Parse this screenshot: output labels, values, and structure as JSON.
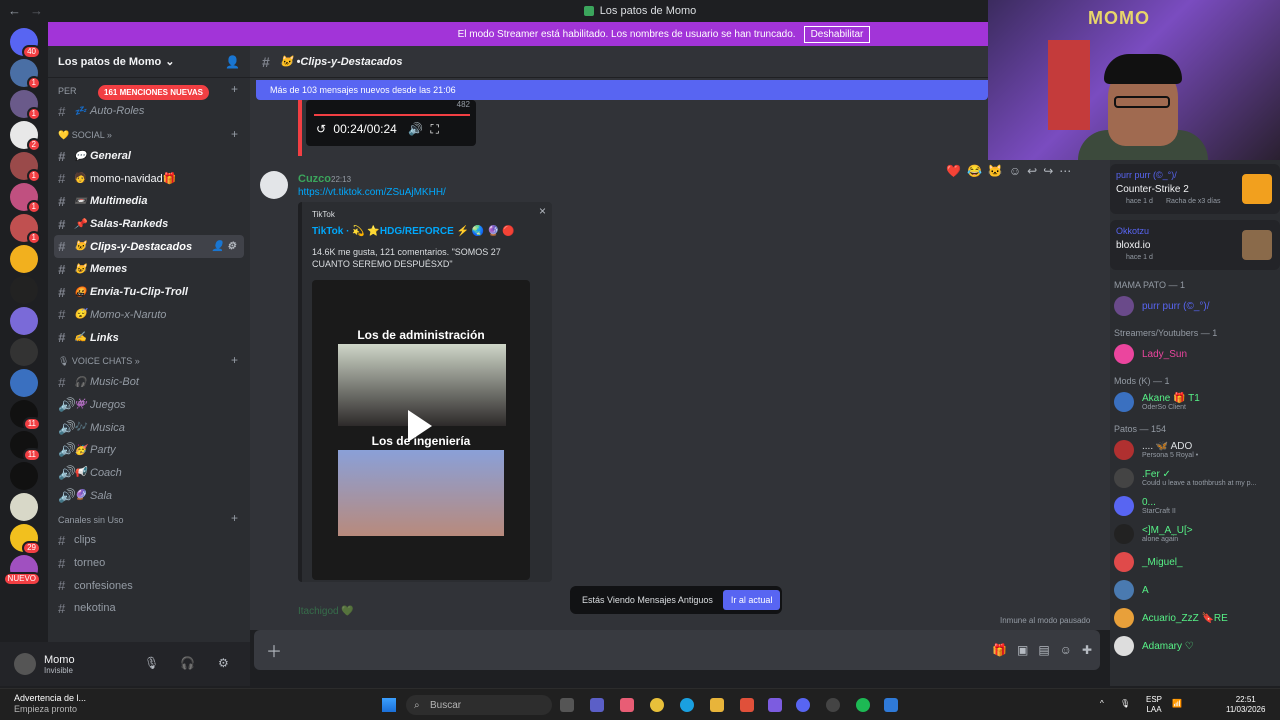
{
  "window": {
    "title": "Los patos de Momo"
  },
  "streamer_banner": {
    "text": "El modo Streamer está habilitado. Los nombres de usuario se han truncado.",
    "button": "Deshabilitar"
  },
  "guilds": [
    {
      "badge": "40"
    },
    {
      "badge": "1"
    },
    {
      "badge": "1"
    },
    {
      "badge": "2"
    },
    {
      "badge": "1"
    },
    {
      "badge": "1"
    },
    {
      "badge": "1"
    },
    {
      "badge": ""
    },
    {
      "badge": ""
    },
    {
      "badge": ""
    },
    {
      "badge": ""
    },
    {
      "badge": ""
    },
    {
      "badge": "11"
    },
    {
      "badge": "11"
    },
    {
      "badge": ""
    },
    {
      "badge": ""
    },
    {
      "badge": "29"
    },
    {
      "badge": "NUEVO"
    }
  ],
  "server": {
    "name": "Los patos de Momo",
    "mentions": "161 MENCIONES NUEVAS"
  },
  "channels": [
    {
      "type": "cat",
      "label": "PER"
    },
    {
      "type": "ch",
      "emoji": "💤",
      "label": "Auto-Roles",
      "style": "ital"
    },
    {
      "type": "cat",
      "label": "💛 SOCIAL »"
    },
    {
      "type": "ch",
      "emoji": "💬",
      "label": "General",
      "style": "bold"
    },
    {
      "type": "ch",
      "emoji": "🧑",
      "label": "momo-navidad🎁",
      "style": "plain-bright"
    },
    {
      "type": "ch",
      "emoji": "📼",
      "label": "Multimedia",
      "style": "bold"
    },
    {
      "type": "ch",
      "emoji": "📌",
      "label": "Salas-Rankeds",
      "style": "bold"
    },
    {
      "type": "ch",
      "emoji": "🐱",
      "label": "Clips-y-Destacados",
      "style": "sel"
    },
    {
      "type": "ch",
      "emoji": "😺",
      "label": "Memes",
      "style": "bold"
    },
    {
      "type": "ch",
      "emoji": "🤬",
      "label": "Envia-Tu-Clip-Troll",
      "style": "bold"
    },
    {
      "type": "ch",
      "emoji": "😴",
      "label": "Momo-x-Naruto",
      "style": "ital"
    },
    {
      "type": "ch",
      "emoji": "✍",
      "label": "Links",
      "style": "bold"
    },
    {
      "type": "cat",
      "label": "🎙 VOICE CHATS »"
    },
    {
      "type": "ch",
      "emoji": "🎧",
      "label": "Music-Bot",
      "style": "ital"
    },
    {
      "type": "vc",
      "emoji": "👾",
      "label": "Juegos",
      "style": "ital"
    },
    {
      "type": "vc",
      "emoji": "🎶",
      "label": "Musica",
      "style": "ital"
    },
    {
      "type": "vc",
      "emoji": "🥳",
      "label": "Party",
      "style": "ital"
    },
    {
      "type": "vc",
      "emoji": "📢",
      "label": "Coach",
      "style": "ital"
    },
    {
      "type": "vc",
      "emoji": "🔮",
      "label": "Sala",
      "style": "ital"
    },
    {
      "type": "cat",
      "label": "Canales sin Uso"
    },
    {
      "type": "ch",
      "emoji": "",
      "label": "clips",
      "style": "plain"
    },
    {
      "type": "ch",
      "emoji": "",
      "label": "torneo",
      "style": "plain"
    },
    {
      "type": "ch",
      "emoji": "",
      "label": "confesiones",
      "style": "plain"
    },
    {
      "type": "ch",
      "emoji": "",
      "label": "nekotina",
      "style": "plain"
    }
  ],
  "user": {
    "name": "Momo",
    "status": "Invisible"
  },
  "header": {
    "channel": "🐱 •Clips-y-Destacados"
  },
  "new_messages": "Más de 103 mensajes nuevos desde las 21:06",
  "video": {
    "time": "00:24/00:24",
    "count": "482"
  },
  "message": {
    "author": "Cuzco",
    "time": "22:13",
    "link": "https://vt.tiktok.com/ZSuAjMKHH/"
  },
  "embed": {
    "provider": "TikTok",
    "title": "TikTok · 💫 ⭐HDG/REFORCE ⚡ 🌏 🔮 🔴",
    "description": "14.6K me gusta, 121 comentarios. \"SOMOS 27 CUANTO SEREMO DESPUÉSXD\"",
    "thumb_text1": "Los de administración",
    "thumb_text2": "Los de ingeniería"
  },
  "reactions": [
    "❤️",
    "😂",
    "🐱"
  ],
  "old_popup": {
    "text": "Estás Viendo Mensajes Antiguos",
    "button": "Ir al actual"
  },
  "faded_author": "Itachigod 💚",
  "immune": "Inmune al modo pausado",
  "members": {
    "activities": [
      {
        "name": "purr purr (©_°)/",
        "game": "Counter-Strike 2",
        "meta": "hace 1 d",
        "meta2": "Racha de x3 días"
      },
      {
        "name": "Okkotzu",
        "game": "bloxd.io",
        "meta": "hace 1 d",
        "meta2": ""
      }
    ],
    "groups": [
      {
        "title": "MAMA PATO — 1",
        "items": [
          {
            "name": "purr purr (©_°)/",
            "color": "#5865f2",
            "sub": ""
          }
        ]
      },
      {
        "title": "Streamers/Youtubers — 1",
        "items": [
          {
            "name": "Lady_Sun",
            "color": "#eb459e",
            "sub": ""
          }
        ]
      },
      {
        "title": "Mods (K) — 1",
        "items": [
          {
            "name": "Akane 🎁 T1",
            "color": "#57f287",
            "sub": "OderSo Client"
          }
        ]
      },
      {
        "title": "Patos — 154",
        "items": [
          {
            "name": ".... 🦋 ADO",
            "color": "#dbdee1",
            "sub": "Persona 5 Royal •"
          },
          {
            "name": ".Fer ✓",
            "color": "#57f287",
            "sub": "Could u leave a toothbrush at my p..."
          },
          {
            "name": "0...",
            "color": "#57f287",
            "sub": "StarCraft II"
          },
          {
            "name": "<]M_A_U[>",
            "color": "#57f287",
            "sub": "alone again"
          },
          {
            "name": "_Miguel_",
            "color": "#57f287",
            "sub": ""
          },
          {
            "name": "A",
            "color": "#57f287",
            "sub": ""
          },
          {
            "name": "Acuario_ZzZ 🔖RE",
            "color": "#57f287",
            "sub": ""
          },
          {
            "name": "Adamary ♡",
            "color": "#57f287",
            "sub": ""
          }
        ]
      }
    ]
  },
  "taskbar": {
    "notice_title": "Advertencia de l...",
    "notice_sub": "Empieza pronto",
    "search": "Buscar",
    "lang": "ESP",
    "lang2": "LAA",
    "clock": "22:51",
    "date": "11/03/2026"
  },
  "webcam": {
    "sign": "MOMO"
  }
}
